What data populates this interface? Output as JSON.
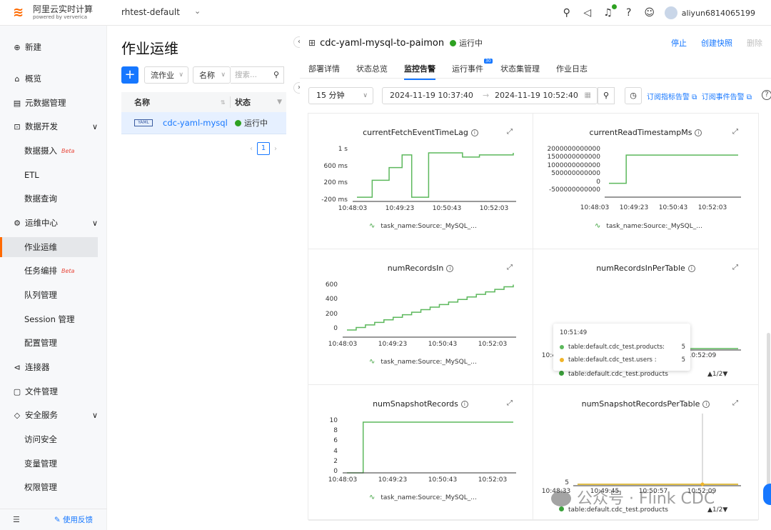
{
  "app": {
    "title": "阿里云实时计算",
    "subtitle": "powered by ververica",
    "workspace": "rhtest-default",
    "user": "aliyun6814065199"
  },
  "topicons": [
    "rocket-icon",
    "megaphone-icon",
    "bell-icon",
    "help-icon",
    "robot-icon"
  ],
  "sidebar": {
    "items": [
      {
        "label": "新建",
        "icon": "⊕",
        "top": 16
      },
      {
        "label": "概览",
        "icon": "⌂",
        "top": 60
      },
      {
        "label": "元数据管理",
        "icon": "▤",
        "top": 94
      },
      {
        "label": "数据开发",
        "icon": "⊡",
        "top": 127,
        "chev": "∨"
      },
      {
        "label": "数据摄入",
        "sub": true,
        "beta": "Beta",
        "top": 161
      },
      {
        "label": "ETL",
        "sub": true,
        "top": 195
      },
      {
        "label": "数据查询",
        "sub": true,
        "top": 228
      },
      {
        "label": "运维中心",
        "icon": "⚙",
        "top": 262,
        "chev": "∨"
      },
      {
        "label": "作业运维",
        "sub": true,
        "active": true,
        "top": 296
      },
      {
        "label": "任务编排",
        "sub": true,
        "beta": "Beta",
        "top": 329
      },
      {
        "label": "队列管理",
        "sub": true,
        "top": 363
      },
      {
        "label": "Session 管理",
        "sub": true,
        "top": 397
      },
      {
        "label": "配置管理",
        "sub": true,
        "top": 430
      },
      {
        "label": "连接器",
        "icon": "⊲",
        "top": 464
      },
      {
        "label": "文件管理",
        "icon": "▢",
        "top": 498
      },
      {
        "label": "安全服务",
        "icon": "◇",
        "top": 531,
        "chev": "∨"
      },
      {
        "label": "访问安全",
        "sub": true,
        "top": 565
      },
      {
        "label": "变量管理",
        "sub": true,
        "top": 599
      },
      {
        "label": "权限管理",
        "sub": true,
        "top": 632
      }
    ],
    "feedback": "使用反馈"
  },
  "list": {
    "title": "作业运维",
    "type_filter": "流作业",
    "name_filter": "名称",
    "search_placeholder": "搜索...",
    "headers": [
      "名称",
      "状态"
    ],
    "rows": [
      {
        "tag": "YAML",
        "name": "cdc-yaml-mysql-to-paimon",
        "status": "运行中"
      }
    ],
    "page": "1"
  },
  "job": {
    "name": "cdc-yaml-mysql-to-paimon",
    "status": "运行中",
    "actions": [
      "停止",
      "创建快照",
      "删除"
    ]
  },
  "tabs": [
    "部署详情",
    "状态总览",
    "监控告警",
    "运行事件",
    "状态集管理",
    "作业日志"
  ],
  "tab_badge": "30",
  "toolbar": {
    "range": "15 分钟",
    "start": "2024-11-19 10:37:40",
    "end": "2024-11-19 10:52:40",
    "sub_metric": "订阅指标告警",
    "sub_event": "订阅事件告警"
  },
  "colors": {
    "series1": "#5cb85c",
    "series2": "#f0b429",
    "accent": "#1677ff",
    "brand": "#ff6a00"
  },
  "panels": [
    {
      "title": "currentFetchEventTimeLag",
      "yticks": [
        "1 s",
        "600 ms",
        "200 ms",
        "-200 ms"
      ],
      "xticks": [
        "10:48:03",
        "10:49:23",
        "10:50:43",
        "10:52:03"
      ],
      "legend": "task_name:Source:_MySQL_..."
    },
    {
      "title": "currentReadTimestampMs",
      "yticks": [
        "2000000000000",
        "1500000000000",
        "1000000000000",
        "500000000000",
        "0",
        "-500000000000"
      ],
      "xticks": [
        "10:48:03",
        "10:49:23",
        "10:50:43",
        "10:52:03"
      ],
      "legend": "task_name:Source:_MySQL_..."
    },
    {
      "title": "numRecordsIn",
      "yticks": [
        "600",
        "400",
        "200",
        "0"
      ],
      "xticks": [
        "10:48:03",
        "10:49:23",
        "10:50:43",
        "10:52:03"
      ],
      "legend": "task_name:Source:_MySQL_..."
    },
    {
      "title": "numRecordsInPerTable",
      "yticks": [
        "5"
      ],
      "xticks": [
        "10:48:33",
        "10:49:45",
        "10:50:57",
        "10:52:09"
      ],
      "legend": "table:default.cdc_test.products",
      "pager": "▲1/2▼"
    },
    {
      "title": "numSnapshotRecords",
      "yticks": [
        "10",
        "8",
        "6",
        "4",
        "2",
        "0"
      ],
      "xticks": [
        "10:48:03",
        "10:49:23",
        "10:50:43",
        "10:52:03"
      ],
      "legend": "task_name:Source:_MySQL_..."
    },
    {
      "title": "numSnapshotRecordsPerTable",
      "yticks": [
        "5"
      ],
      "xticks": [
        "10:48:33",
        "10:49:45",
        "10:50:57",
        "10:52:09"
      ],
      "legend": "table:default.cdc_test.products",
      "pager": "▲1/2▼"
    }
  ],
  "tooltip": {
    "time": "10:51:49",
    "rows": [
      {
        "label": "table:default.cdc_test.products:",
        "value": "5"
      },
      {
        "label": "table:default.cdc_test.users   :",
        "value": "5"
      }
    ]
  },
  "watermark": "公众号 · Flink CDC",
  "chart_data": [
    {
      "type": "line",
      "title": "currentFetchEventTimeLag",
      "unit": "ms",
      "x": [
        "10:48:03",
        "10:48:30",
        "10:49:00",
        "10:49:23",
        "10:49:40",
        "10:50:10",
        "10:50:43",
        "10:51:10",
        "10:51:40",
        "10:52:03",
        "10:52:40"
      ],
      "series": [
        {
          "values": [
            -100,
            300,
            600,
            900,
            -100,
            950,
            950,
            850,
            900,
            900,
            950
          ]
        }
      ]
    },
    {
      "type": "line",
      "title": "currentReadTimestampMs",
      "x": [
        "10:48:03",
        "10:48:20",
        "10:48:40",
        "10:52:40"
      ],
      "series": [
        {
          "values": [
            0,
            0,
            1732000000000,
            1732000000000
          ]
        }
      ]
    },
    {
      "type": "line",
      "title": "numRecordsIn",
      "x": [
        "10:48:03",
        "10:52:40"
      ],
      "series": [
        {
          "values": [
            0,
            625
          ]
        }
      ]
    },
    {
      "type": "line",
      "title": "numRecordsInPerTable",
      "x": [
        "10:48:33",
        "10:52:40"
      ],
      "series": [
        {
          "name": "table:default.cdc_test.products",
          "values": [
            5,
            5
          ]
        }
      ]
    },
    {
      "type": "line",
      "title": "numSnapshotRecords",
      "x": [
        "10:48:03",
        "10:48:30",
        "10:52:40"
      ],
      "series": [
        {
          "values": [
            0,
            10,
            10
          ]
        }
      ]
    },
    {
      "type": "line",
      "title": "numSnapshotRecordsPerTable",
      "x": [
        "10:48:33",
        "10:52:40"
      ],
      "series": [
        {
          "name": "table:default.cdc_test.products",
          "values": [
            5,
            5
          ]
        },
        {
          "name": "table:default.cdc_test.users",
          "values": [
            5,
            5
          ]
        }
      ]
    }
  ]
}
